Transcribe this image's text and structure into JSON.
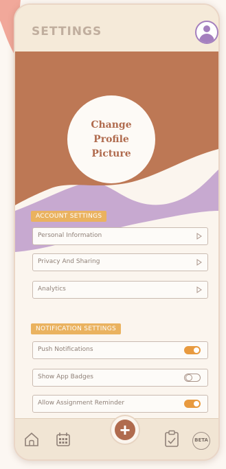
{
  "header": {
    "title": "SETTINGS"
  },
  "profile": {
    "label": "Change Profile Picture"
  },
  "account": {
    "section_label": "ACCOUNT SETTINGS",
    "items": [
      {
        "label": "Personal Information"
      },
      {
        "label": "Privacy And Sharing"
      },
      {
        "label": "Analytics"
      }
    ]
  },
  "notifications": {
    "section_label": "NOTIFICATION SETTINGS",
    "items": [
      {
        "label": "Push Notifications",
        "enabled": true
      },
      {
        "label": "Show App Badges",
        "enabled": false
      },
      {
        "label": "Allow Assignment Reminder",
        "enabled": true
      }
    ]
  },
  "nav": {
    "beta_label": "BETA",
    "fab_symbol": "+"
  },
  "colors": {
    "accent_brown": "#b06b4e",
    "accent_purple": "#a47fbe",
    "accent_orange": "#eab25f",
    "toggle_on": "#e89a3f"
  },
  "icons": [
    "user-icon",
    "chevron-right-icon",
    "toggle-icon",
    "home-icon",
    "calendar-icon",
    "plus-icon",
    "clipboard-icon"
  ]
}
